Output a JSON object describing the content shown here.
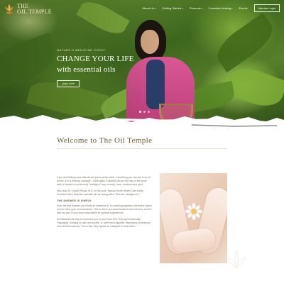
{
  "brand": {
    "logo_line1": "THE",
    "logo_line2": "OIL TEMPLE",
    "accent": "#6f5b39",
    "green": "#5f7f3a"
  },
  "nav": {
    "items": [
      {
        "label": "About Us",
        "has_menu": true
      },
      {
        "label": "Getting Started",
        "has_menu": true
      },
      {
        "label": "Products",
        "has_menu": true
      },
      {
        "label": "Essential Healing",
        "has_menu": true
      },
      {
        "label": "Events",
        "has_menu": false
      }
    ],
    "member_login": "Member login"
  },
  "hero": {
    "kicker": "Nature's Medicine Chest",
    "title_line1": "Change your life",
    "title_line2": "with essential oils",
    "button": "Learn more",
    "slides": 3,
    "active_slide": 1
  },
  "welcome": {
    "title": "Welcome to The Oil Temple"
  },
  "content": {
    "p1": "If you are thinking essential oils are just a pretty smell – something you can use in an oil burner or in a relaxing massage – think again. Essential oils are the way of the future able to impact in a profoundly \"intelligent\" way on body, mind, emotions and spirit.",
    "p1_link": "think again",
    "p2": "Why does Dr. Daniel Penoel, M.D. (in his book \"Natural Home Health Care Using Essential Oils\") describe essential oils as acting with a \"Bee-like Intelligence\"?",
    "subhead": "THE ANSWER IS SIMPLE",
    "p3": "From the first moment you inhale an essential oil, it is sending signals to the limbic region of your brain (your subconscious). This is where you store emotions and memory, and it's also the part of your brain responsible for spiritual experiences.",
    "p4": "So essential oils help to reconnect you to your Inner Self. They are emotionally \"regulating\" (helping to calm and soothe, or uplift and invigorate, depending on what you need at that moment). This is why they appear so intelligent in their action."
  },
  "icons": {
    "logo": "lotus-icon",
    "dropdown": "chevron-down-icon",
    "flower": "daisy-icon"
  }
}
